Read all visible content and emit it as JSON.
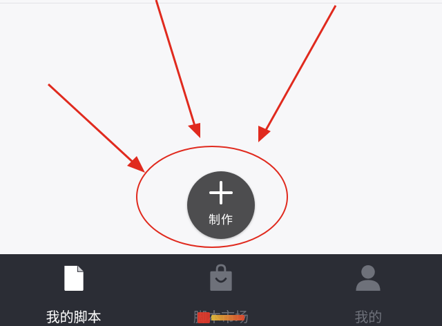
{
  "main": {
    "make_button": {
      "label": "制作",
      "icon": "plus-icon"
    }
  },
  "tabbar": {
    "tabs": [
      {
        "label": "我的脚本",
        "icon": "document-icon",
        "active": true
      },
      {
        "label": "脚本市场",
        "icon": "shopping-bag-icon",
        "active": false
      },
      {
        "label": "我的",
        "icon": "person-icon",
        "active": false
      }
    ]
  },
  "colors": {
    "tabbar_bg": "#2b2d35",
    "active": "#ffffff",
    "inactive": "#6e717a",
    "make_button_bg": "#4d4d4f",
    "annotation_red": "#e02a1e"
  }
}
